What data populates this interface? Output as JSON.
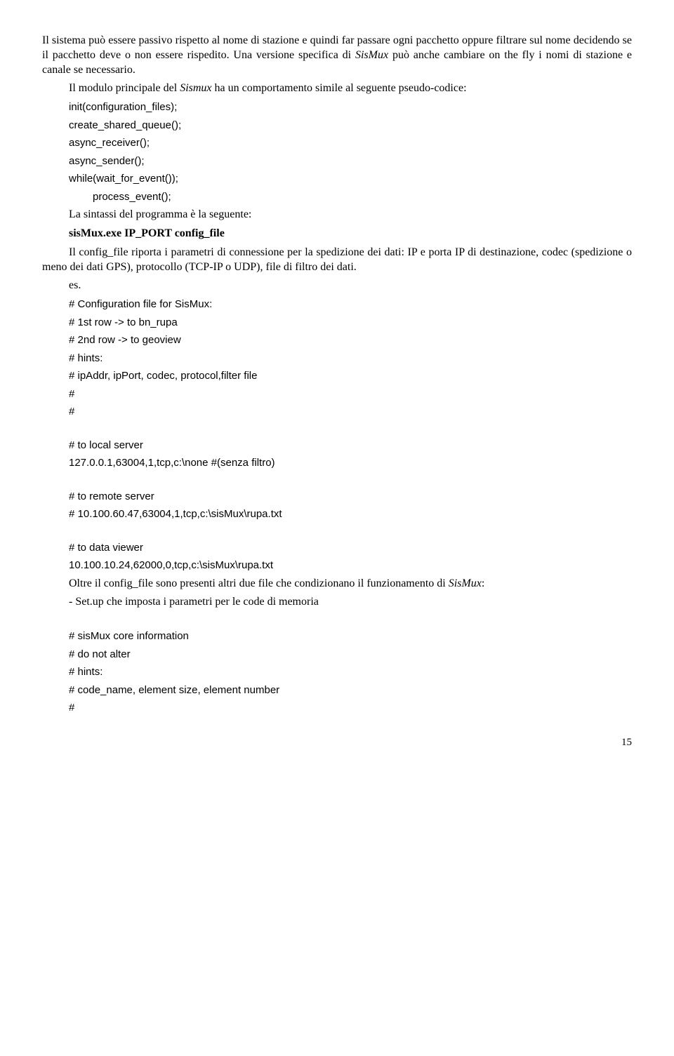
{
  "para1": "Il sistema può essere passivo rispetto al nome di stazione e quindi far passare ogni pacchetto oppure filtrare sul nome decidendo se il pacchetto deve o non essere rispedito. Una versione specifica di ",
  "para1_it": "SisMux",
  "para1_cont": " può anche cambiare on the fly i nomi di stazione e canale se necessario.",
  "para2_a": "Il modulo principale del ",
  "para2_it": "Sismux",
  "para2_b": " ha un comportamento simile al seguente pseudo-codice:",
  "code1": "init(configuration_files);",
  "code2": "create_shared_queue();",
  "code3": "async_receiver();",
  "code4": "async_sender();",
  "code5": "while(wait_for_event());",
  "code6": "process_event();",
  "para3": "La sintassi del programma è la seguente:",
  "cmd": "sisMux.exe IP_PORT config_file",
  "para4": "Il config_file riporta i parametri di connessione per la spedizione dei dati: IP e porta IP di destinazione, codec (spedizione o meno dei dati GPS), protocollo (TCP-IP o UDP), file di filtro dei dati.",
  "es": "es.",
  "cfg1": "# Configuration file for SisMux:",
  "cfg2": "# 1st row -> to bn_rupa",
  "cfg3": "# 2nd row -> to geoview",
  "cfg4": "# hints:",
  "cfg5": "# ipAddr, ipPort, codec, protocol,filter file",
  "cfg6": "#",
  "cfg7": "#",
  "cfg8": "# to local server",
  "cfg9": "127.0.0.1,63004,1,tcp,c:\\none #(senza filtro)",
  "cfg10": "# to remote server",
  "cfg11": "# 10.100.60.47,63004,1,tcp,c:\\sisMux\\rupa.txt",
  "cfg12": "# to data viewer",
  "cfg13": "10.100.10.24,62000,0,tcp,c:\\sisMux\\rupa.txt",
  "para5_a": "Oltre il config_file sono presenti altri due file che condizionano il funzionamento di ",
  "para5_it": "SisMux",
  "para5_b": ":",
  "para6": "- Set.up che imposta i parametri per le code di memoria",
  "core1": "# sisMux core information",
  "core2": "# do not alter",
  "core3": "# hints:",
  "core4": "# code_name, element size, element number",
  "core5": "#",
  "pagenum": "15"
}
